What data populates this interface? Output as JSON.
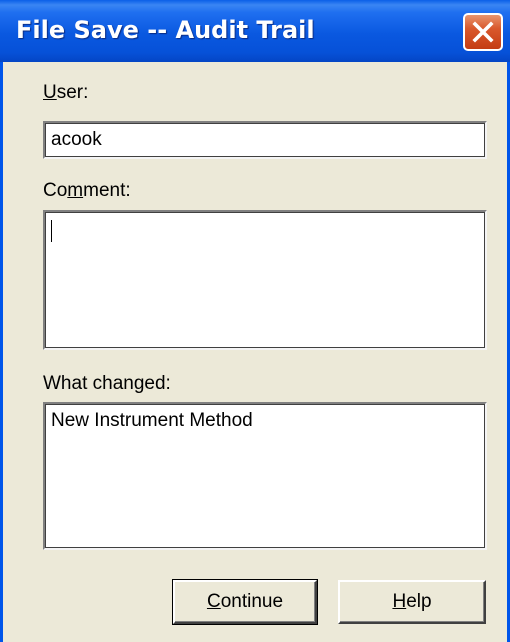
{
  "window": {
    "title": "File Save -- Audit Trail"
  },
  "titlebar": {
    "close_icon": "close-icon",
    "close_color": "#d9582c",
    "accent": "#0a58e0"
  },
  "form": {
    "user_label_accel": "U",
    "user_label_rest": "ser:",
    "user_value": "acook",
    "comment_label_pre": "Co",
    "comment_label_accel": "m",
    "comment_label_rest": "ment:",
    "comment_value": "",
    "changed_label": "What changed:",
    "changed_value": "New Instrument Method"
  },
  "buttons": {
    "continue_accel": "C",
    "continue_rest": "ontinue",
    "help_accel": "H",
    "help_rest": "elp"
  }
}
